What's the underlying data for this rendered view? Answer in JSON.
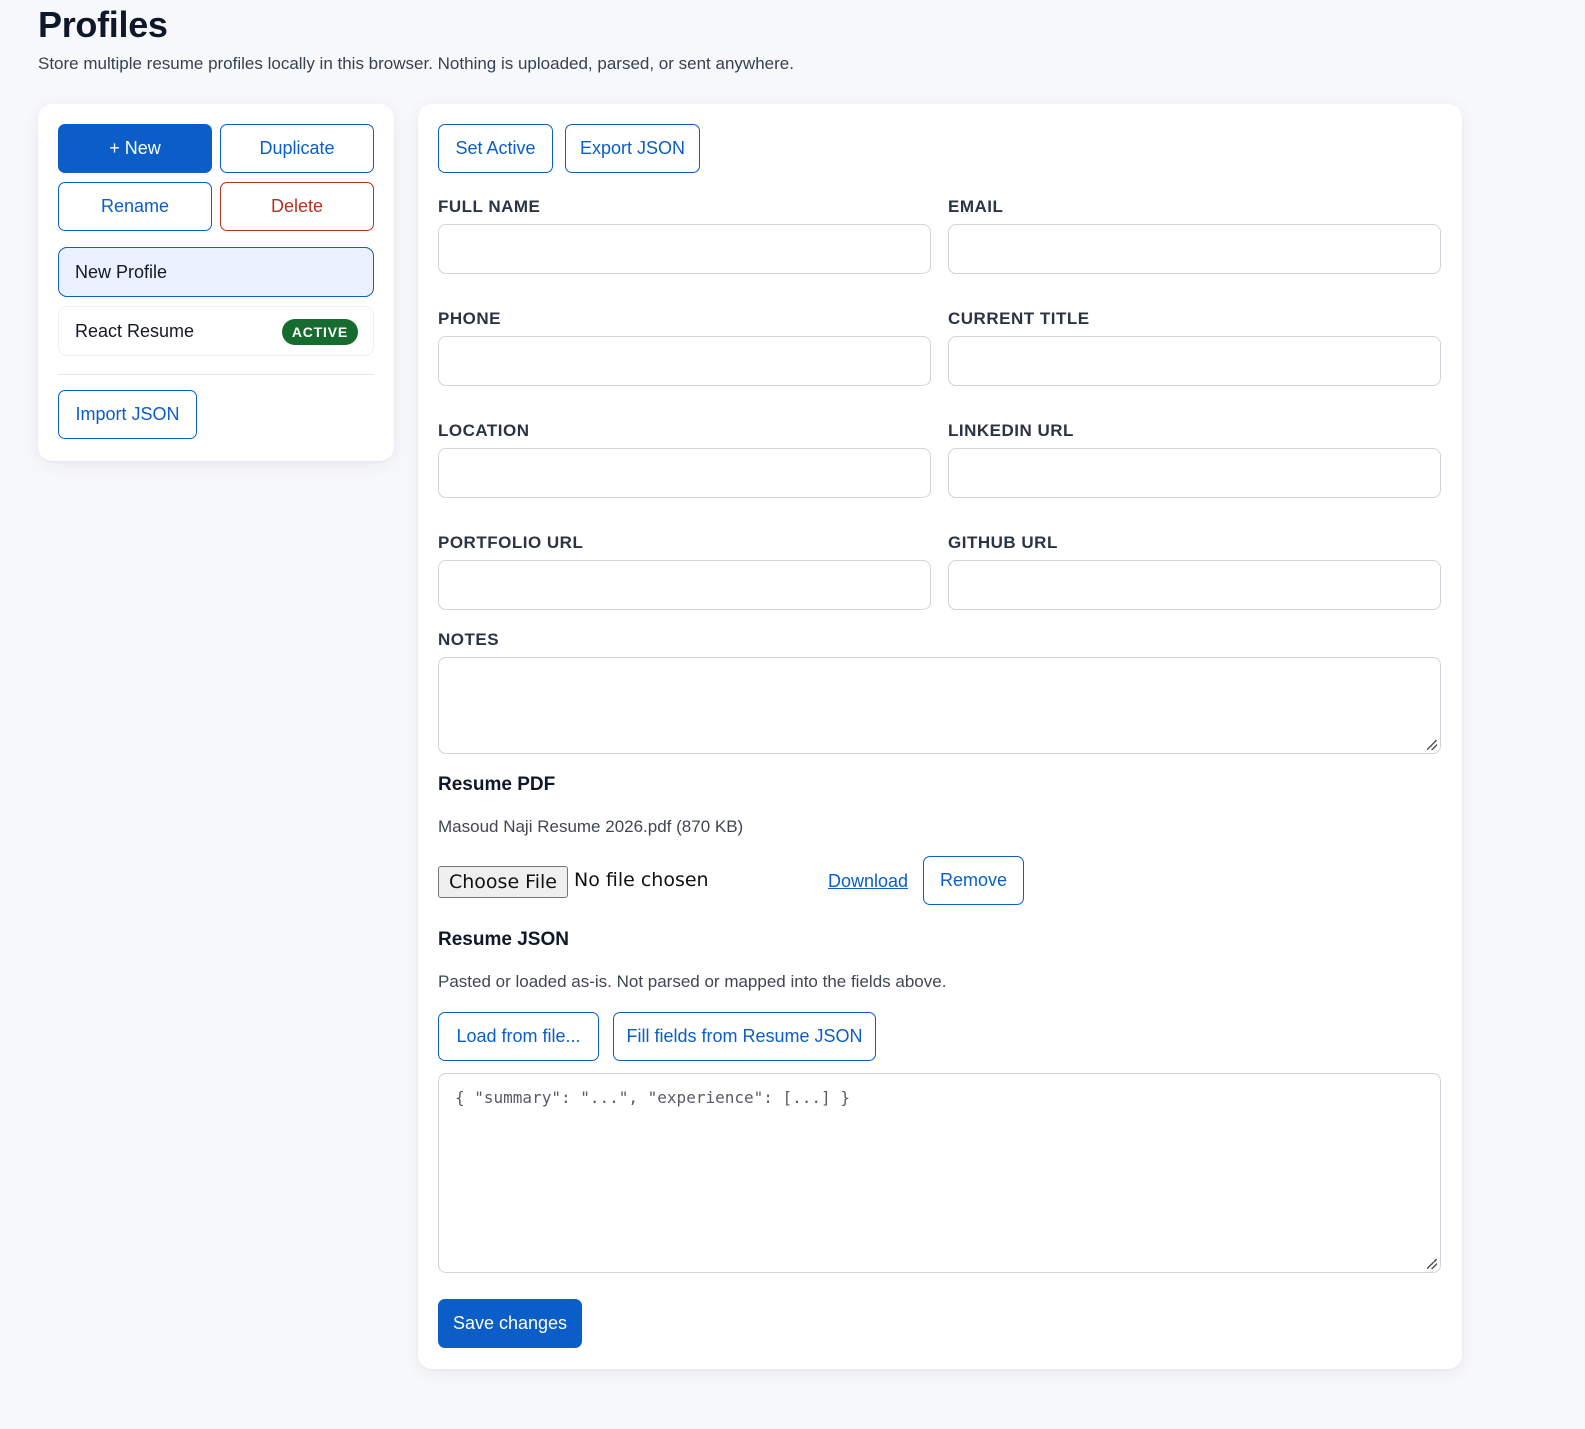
{
  "header": {
    "title": "Profiles",
    "subtitle": "Store multiple resume profiles locally in this browser. Nothing is uploaded, parsed, or sent anywhere."
  },
  "sidebar": {
    "new_label": "+ New",
    "duplicate_label": "Duplicate",
    "rename_label": "Rename",
    "delete_label": "Delete",
    "profiles": [
      {
        "name": "New Profile",
        "selected": true,
        "badge": ""
      },
      {
        "name": "React Resume",
        "selected": false,
        "badge": "ACTIVE"
      }
    ],
    "import_label": "Import JSON"
  },
  "editor": {
    "set_active_label": "Set Active",
    "export_label": "Export JSON",
    "fields": {
      "full_name": {
        "label": "FULL NAME",
        "value": ""
      },
      "email": {
        "label": "EMAIL",
        "value": ""
      },
      "phone": {
        "label": "PHONE",
        "value": ""
      },
      "current_title": {
        "label": "CURRENT TITLE",
        "value": ""
      },
      "location": {
        "label": "LOCATION",
        "value": ""
      },
      "linkedin_url": {
        "label": "LINKEDIN URL",
        "value": ""
      },
      "portfolio_url": {
        "label": "PORTFOLIO URL",
        "value": ""
      },
      "github_url": {
        "label": "GITHUB URL",
        "value": ""
      },
      "notes": {
        "label": "NOTES",
        "value": ""
      }
    },
    "resume_pdf": {
      "title": "Resume PDF",
      "file_info": "Masoud Naji Resume 2026.pdf (870 KB)",
      "choose_file_label": "Choose File",
      "file_status": "No file chosen",
      "download_label": "Download",
      "remove_label": "Remove"
    },
    "resume_json": {
      "title": "Resume JSON",
      "helper": "Pasted or loaded as-is. Not parsed or mapped into the fields above.",
      "load_label": "Load from file...",
      "fill_label": "Fill fields from Resume JSON",
      "placeholder": "{ \"summary\": \"...\", \"experience\": [...] }",
      "value": ""
    },
    "save_label": "Save changes"
  },
  "colors": {
    "accent": "#0b5ec7",
    "danger": "#b4321f",
    "active_badge": "#166b2e",
    "selected_bg": "#eaf2fd",
    "page_bg": "#f7f8fb"
  }
}
